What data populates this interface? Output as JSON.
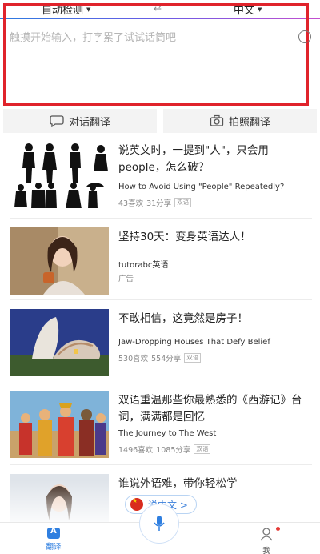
{
  "header": {
    "source_lang": "自动检测",
    "target_lang": "中文",
    "accent_colors": [
      "#2d7be0",
      "#6a5be6",
      "#c44fd0"
    ]
  },
  "input": {
    "placeholder": "触摸开始输入，打字累了试试话筒吧",
    "border_color": "#e0232b"
  },
  "modes": {
    "dialog_label": "对话翻译",
    "photo_label": "拍照翻译"
  },
  "feed": [
    {
      "title": "说英文时，一提到\"人\"，只会用people，怎么破？",
      "subtitle": "How to Avoid Using \"People\" Repeatedly?",
      "likes": "43喜欢",
      "shares": "31分享",
      "tag": "双语"
    },
    {
      "title": "坚持30天：变身英语达人！",
      "subtitle": "tutorabc英语",
      "ad": "广告"
    },
    {
      "title": "不敢相信，这竟然是房子！",
      "subtitle": "Jaw-Dropping Houses That Defy Belief",
      "likes": "530喜欢",
      "shares": "554分享",
      "tag": "双语"
    },
    {
      "title": "双语重温那些你最熟悉的《西游记》台词，满满都是回忆",
      "subtitle": "The Journey to The West",
      "likes": "1496喜欢",
      "shares": "1085分享",
      "tag": "双语"
    },
    {
      "title": "谁说外语难，带你轻松学"
    }
  ],
  "speak_pill": {
    "label": "说中文 >"
  },
  "bottom_nav": {
    "translate_label": "翻译",
    "me_label": "我"
  }
}
